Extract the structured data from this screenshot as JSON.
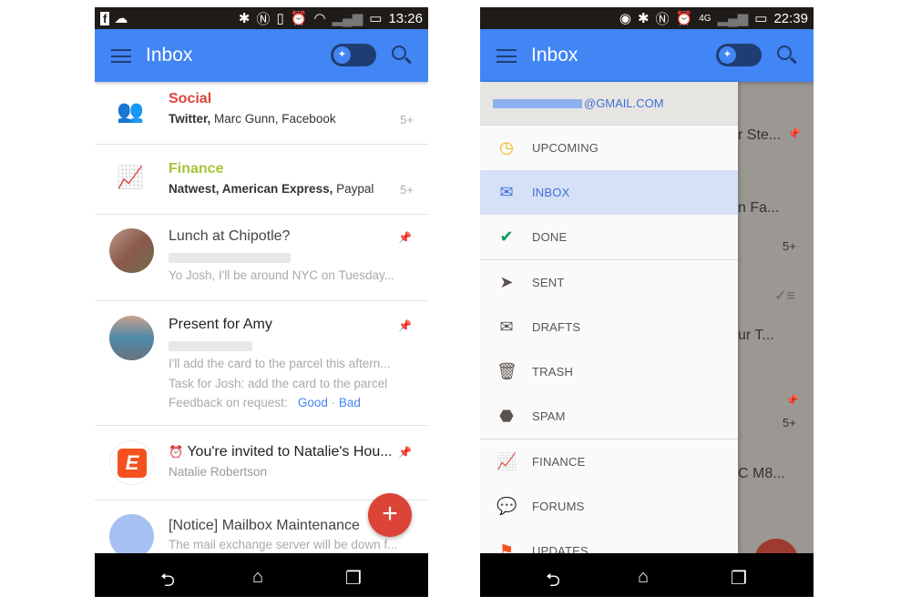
{
  "left": {
    "status": {
      "time": "13:26",
      "icons": [
        "facebook-icon",
        "cloud-check-icon",
        "bluetooth-icon",
        "nfc-icon",
        "vibrate-icon",
        "alarm-icon",
        "wifi-icon",
        "signal-icon",
        "battery-icon"
      ]
    },
    "appbar": {
      "title": "Inbox"
    },
    "bundles": [
      {
        "title": "Social",
        "senders_bold": "Twitter,",
        "senders": " Marc Gunn, Facebook",
        "count": "5+",
        "color": "#db4437"
      },
      {
        "title": "Finance",
        "senders_bold": "Natwest, American Express,",
        "senders": " Paypal",
        "count": "5+",
        "color": "#a4c639"
      }
    ],
    "emails": [
      {
        "subject": "Lunch at Chipotle?",
        "snippet": "Yo Josh, I'll be around NYC on Tuesday..."
      },
      {
        "subject": "Present for Amy",
        "snippet": "I'll add the card to the parcel this aftern...",
        "task": "Task for Josh: add the card to the parcel",
        "feedback": "Feedback on request:",
        "good": "Good",
        "sep": "·",
        "bad": "Bad"
      },
      {
        "subject": "You're invited to Natalie's Hou...",
        "sender": "Natalie Robertson",
        "avatar_letter": "E"
      },
      {
        "subject": "[Notice] Mailbox Maintenance",
        "snippet": "The mail exchange server will be down f..."
      }
    ],
    "fab": "+"
  },
  "right": {
    "status": {
      "time": "22:39"
    },
    "appbar": {
      "title": "Inbox"
    },
    "account": "@GMAIL.COM",
    "items": [
      {
        "label": "UPCOMING",
        "icon": "clock-icon",
        "color": "#f4b400"
      },
      {
        "label": "INBOX",
        "icon": "envelope-icon",
        "color": "#3f6fd6",
        "selected": true
      },
      {
        "label": "DONE",
        "icon": "check-icon",
        "color": "#0f9d58"
      },
      {
        "label": "SENT",
        "icon": "send-icon",
        "color": "#5a524c"
      },
      {
        "label": "DRAFTS",
        "icon": "drafts-icon",
        "color": "#5a524c"
      },
      {
        "label": "TRASH",
        "icon": "trash-icon",
        "color": "#5a524c"
      },
      {
        "label": "SPAM",
        "icon": "spam-icon",
        "color": "#5a524c"
      },
      {
        "label": "FINANCE",
        "icon": "finance-icon",
        "color": "#a4c639"
      },
      {
        "label": "FORUMS",
        "icon": "forums-icon",
        "color": "#3f51b5"
      },
      {
        "label": "UPDATES",
        "icon": "flag-icon",
        "color": "#f4511e"
      }
    ],
    "background": {
      "frag1": "r Ste...",
      "frag2": "n Fa...",
      "count1": "5+",
      "frag3": "ur T...",
      "count2": "5+",
      "frag4": "C M8..."
    }
  },
  "nav": {
    "back": "⮌",
    "home": "⌂",
    "recents": "❐"
  }
}
